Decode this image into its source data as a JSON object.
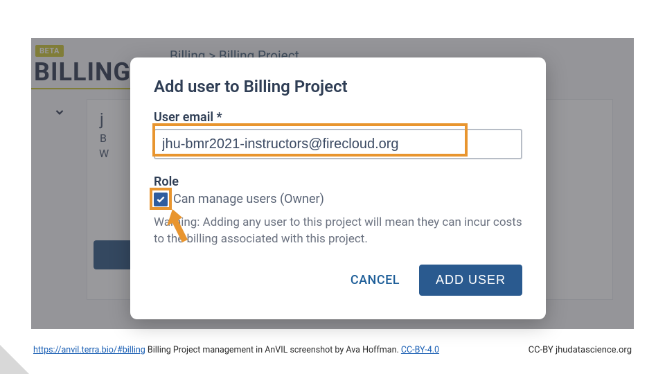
{
  "header": {
    "beta_badge": "BETA",
    "page_title": "BILLING",
    "breadcrumb": "Billing > Billing Project"
  },
  "back_panel": {
    "title_char": "j",
    "sub1": "B",
    "sub2": "W"
  },
  "modal": {
    "title": "Add user to Billing Project",
    "email_label": "User email *",
    "email_value": "jhu-bmr2021-instructors@firecloud.org",
    "role_label": "Role",
    "role_option": "Can manage users (Owner)",
    "role_checked": true,
    "warning": "Warning: Adding any user to this project will mean they can incur costs to the billing associated with this project.",
    "cancel_label": "CANCEL",
    "add_label": "ADD USER"
  },
  "annotations": {
    "highlight_color": "#e8952f"
  },
  "caption": {
    "url_text": "https://anvil.terra.bio/#billing",
    "desc": " Billing Project management in AnVIL screenshot by Ava Hoffman. ",
    "license_text": "CC-BY-4.0",
    "cc_right": "CC-BY  jhudatascience.org"
  }
}
